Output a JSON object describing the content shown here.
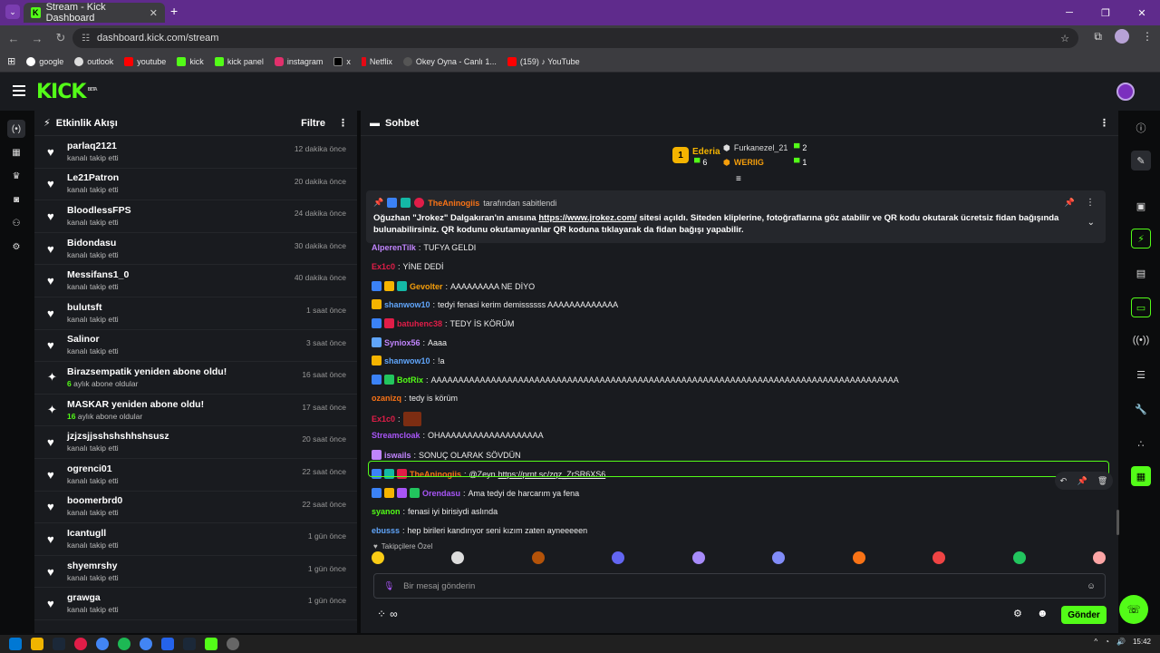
{
  "browser": {
    "tab_title": "Stream - Kick Dashboard",
    "url": "dashboard.kick.com/stream",
    "bookmarks": [
      "google",
      "outlook",
      "youtube",
      "kick",
      "kick panel",
      "instagram",
      "x",
      "Netflix",
      "Okey Oyna - Canlı 1...",
      "(159) ♪ YouTube"
    ]
  },
  "kick": {
    "logo": "KICK",
    "logo_tag": "BETA"
  },
  "activity": {
    "title": "Etkinlik Akışı",
    "filter": "Filtre",
    "items": [
      {
        "name": "parlaq2121",
        "sub": "kanalı takip etti",
        "time": "12 dakika önce",
        "icon": "heart"
      },
      {
        "name": "Le21Patron",
        "sub": "kanalı takip etti",
        "time": "20 dakika önce",
        "icon": "heart"
      },
      {
        "name": "BloodlessFPS",
        "sub": "kanalı takip etti",
        "time": "24 dakika önce",
        "icon": "heart"
      },
      {
        "name": "Bidondasu",
        "sub": "kanalı takip etti",
        "time": "30 dakika önce",
        "icon": "heart"
      },
      {
        "name": "Messifans1_0",
        "sub": "kanalı takip etti",
        "time": "40 dakika önce",
        "icon": "heart"
      },
      {
        "name": "bulutsft",
        "sub": "kanalı takip etti",
        "time": "1 saat önce",
        "icon": "heart"
      },
      {
        "name": "Salinor",
        "sub": "kanalı takip etti",
        "time": "3 saat önce",
        "icon": "heart"
      },
      {
        "name": "Birazsempatik yeniden abone oldu!",
        "sub_num": "6",
        "sub": "aylık abone oldular",
        "time": "16 saat önce",
        "icon": "sparkle"
      },
      {
        "name": "MASKAR yeniden abone oldu!",
        "sub_num": "16",
        "sub": "aylık abone oldular",
        "time": "17 saat önce",
        "icon": "sparkle"
      },
      {
        "name": "jzjzsjjsshshshhshsusz",
        "sub": "kanalı takip etti",
        "time": "20 saat önce",
        "icon": "heart"
      },
      {
        "name": "ogrenci01",
        "sub": "kanalı takip etti",
        "time": "22 saat önce",
        "icon": "heart"
      },
      {
        "name": "boomerbrd0",
        "sub": "kanalı takip etti",
        "time": "22 saat önce",
        "icon": "heart"
      },
      {
        "name": "Icantugll",
        "sub": "kanalı takip etti",
        "time": "1 gün önce",
        "icon": "heart"
      },
      {
        "name": "shyemrshy",
        "sub": "kanalı takip etti",
        "time": "1 gün önce",
        "icon": "heart"
      },
      {
        "name": "grawga",
        "sub": "kanalı takip etti",
        "time": "1 gün önce",
        "icon": "heart"
      }
    ]
  },
  "chat": {
    "title": "Sohbet",
    "leaderboard": {
      "first": {
        "rank": "1",
        "name": "Ederia",
        "count": "6"
      },
      "second": {
        "name": "Furkanezel_21",
        "count": "2"
      },
      "third": {
        "name": "WERIIG",
        "count": "1"
      }
    },
    "pinned": {
      "by_user": "TheAninogiis",
      "by_text": "tarafından sabitlendi",
      "text_1": "Oğuzhan \"Jrokez\" Dalgakıran'ın anısına ",
      "link": "https://www.jrokez.com/",
      "text_2": " sitesi açıldı. Siteden kliplerine, fotoğraflarına göz atabilir ve QR kodu okutarak ücretsiz fidan bağışında bulunabilirsiniz. QR kodunu okutamayanlar QR koduna tıklayarak da fidan bağışı yapabilir."
    },
    "messages": [
      {
        "user": "AlperenTilk",
        "color": "#c084fc",
        "text": "TUFYA GELDI"
      },
      {
        "user": "Ex1c0",
        "color": "#e11d48",
        "text": "YİNE DEDİ"
      },
      {
        "user": "Gevolter",
        "color": "#f59e0b",
        "text": "AAAAAAAAA NE DİYO"
      },
      {
        "user": "shanwow10",
        "color": "#60a5fa",
        "text": "tedyi fenasi kerim demissssss AAAAAAAAAAAAA"
      },
      {
        "user": "batuhenc38",
        "color": "#e11d48",
        "text": "TEDY İS KÖRÜM"
      },
      {
        "user": "Syniox56",
        "color": "#c084fc",
        "text": "Aaaa"
      },
      {
        "user": "shanwow10",
        "color": "#60a5fa",
        "text": "!a"
      },
      {
        "user": "BotRix",
        "color": "#53fc18",
        "text": "AAAAAAAAAAAAAAAAAAAAAAAAAAAAAAAAAAAAAAAAAAAAAAAAAAAAAAAAAAAAAAAAAAAAAAAAAAAAAAAAAAAAAA"
      },
      {
        "user": "ozanizq",
        "color": "#f97316",
        "text": "tedy is körüm"
      },
      {
        "user": "Ex1c0",
        "color": "#e11d48",
        "text": ""
      },
      {
        "user": "Streamcloak",
        "color": "#a855f7",
        "text": "OHAAAAAAAAAAAAAAAAAAA"
      },
      {
        "user": "iswails",
        "color": "#c084fc",
        "text": "SONUÇ OLARAK SÖVDÜN"
      },
      {
        "user": "TheAninogiis",
        "color": "#f97316",
        "text": "@Zeyn ",
        "link": "https://prnt.sc/zqz_ZrSR6XS6"
      },
      {
        "user": "Orendasu",
        "color": "#a855f7",
        "text": "Ama tedyi de harcarım ya fena"
      },
      {
        "user": "syanon",
        "color": "#53fc18",
        "text": "fenasi iyi birisiydi aslında"
      },
      {
        "user": "ebusss",
        "color": "#60a5fa",
        "text": "hep birileri kandırıyor seni kızım zaten ayneeeeen"
      }
    ],
    "followers_only": "Takipçilere Özel",
    "input_placeholder": "Bir mesaj gönderin",
    "send_label": "Gönder",
    "infinity": "∞"
  },
  "taskbar": {
    "time": "15:42"
  }
}
